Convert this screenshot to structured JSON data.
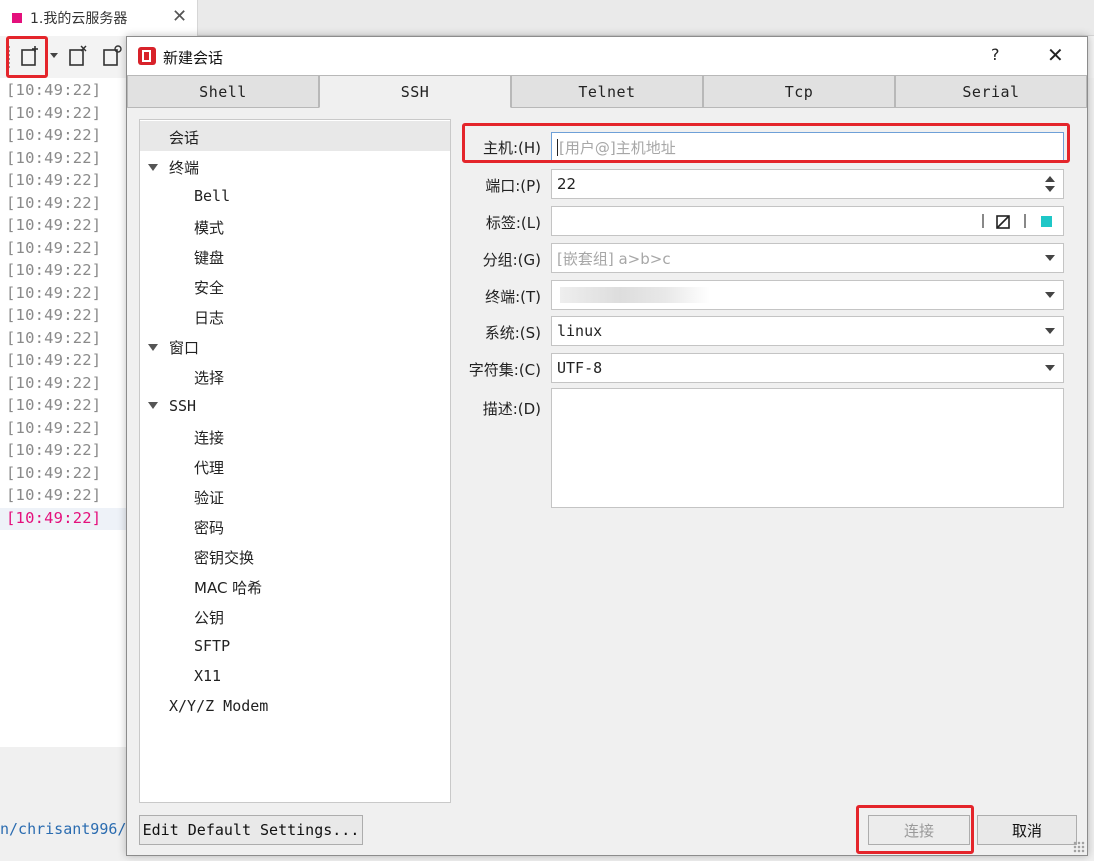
{
  "app": {
    "tab_title": "1.我的云服务器",
    "tab_close": "✕",
    "terminal_lines": [
      "[10:49:22]",
      "[10:49:22]",
      "[10:49:22]",
      "[10:49:22]",
      "[10:49:22]",
      "[10:49:22]",
      "[10:49:22]",
      "[10:49:22]",
      "[10:49:22]",
      "[10:49:22]",
      "[10:49:22]",
      "[10:49:22]",
      "[10:49:22]",
      "[10:49:22]",
      "[10:49:22]",
      "[10:49:22]",
      "[10:49:22]",
      "[10:49:22]",
      "[10:49:22]",
      "[10:49:22]"
    ],
    "path_text": "n/chrisant996/",
    "colors": {
      "highlight": "#e4252b",
      "tab_dot": "#e4107c",
      "active_line": "#e4107c"
    }
  },
  "dialog": {
    "title": "新建会话",
    "help": "?",
    "close": "✕",
    "tabs": [
      {
        "label": "Shell",
        "active": false
      },
      {
        "label": "SSH",
        "active": true
      },
      {
        "label": "Telnet",
        "active": false
      },
      {
        "label": "Tcp",
        "active": false
      },
      {
        "label": "Serial",
        "active": false
      }
    ],
    "nav": [
      {
        "label": "会话",
        "level": 0,
        "selected": true
      },
      {
        "label": "终端",
        "level": 0,
        "expanded": true
      },
      {
        "label": "Bell",
        "level": 1
      },
      {
        "label": "模式",
        "level": 1
      },
      {
        "label": "键盘",
        "level": 1
      },
      {
        "label": "安全",
        "level": 1
      },
      {
        "label": "日志",
        "level": 1
      },
      {
        "label": "窗口",
        "level": 0,
        "expanded": true
      },
      {
        "label": "选择",
        "level": 1
      },
      {
        "label": "SSH",
        "level": 0,
        "expanded": true
      },
      {
        "label": "连接",
        "level": 1
      },
      {
        "label": "代理",
        "level": 1
      },
      {
        "label": "验证",
        "level": 1
      },
      {
        "label": "密码",
        "level": 1
      },
      {
        "label": "密钥交换",
        "level": 1
      },
      {
        "label": "MAC 哈希",
        "level": 1
      },
      {
        "label": "公钥",
        "level": 1
      },
      {
        "label": "SFTP",
        "level": 1
      },
      {
        "label": "X11",
        "level": 1
      },
      {
        "label": "X/Y/Z Modem",
        "level": 0
      }
    ],
    "form": {
      "host_label": "主机:(H)",
      "host_placeholder": "[用户@]主机地址",
      "port_label": "端口:(P)",
      "port_value": "22",
      "tag_label": "标签:(L)",
      "tag_value": "",
      "tag_color": "#1fc7c7",
      "group_label": "分组:(G)",
      "group_placeholder": "[嵌套组] a>b>c",
      "terminal_label": "终端:(T)",
      "terminal_value": "",
      "system_label": "系统:(S)",
      "system_value": "linux",
      "charset_label": "字符集:(C)",
      "charset_value": "UTF-8",
      "desc_label": "描述:(D)",
      "desc_value": ""
    },
    "buttons": {
      "edit_defaults": "Edit Default Settings...",
      "connect": "连接",
      "cancel": "取消"
    }
  }
}
